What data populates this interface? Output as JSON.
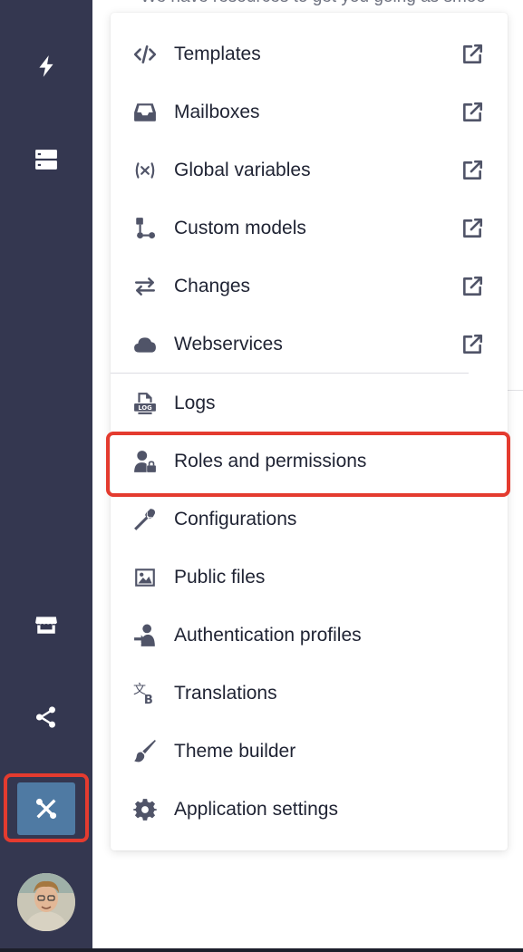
{
  "background": {
    "intro_text": "We have resources to get you going as smoo"
  },
  "sidebar": {
    "icons": [
      {
        "name": "bolt-icon"
      },
      {
        "name": "server-icon"
      },
      {
        "name": "store-icon"
      },
      {
        "name": "share-nodes-icon"
      },
      {
        "name": "tools-icon",
        "active": true
      }
    ],
    "active_color": "#4f7aa3",
    "background_color": "#343750"
  },
  "menu": {
    "external_items": [
      {
        "label": "Templates",
        "icon": "code-icon"
      },
      {
        "label": "Mailboxes",
        "icon": "inbox-icon"
      },
      {
        "label": "Global variables",
        "icon": "variable-icon"
      },
      {
        "label": "Custom models",
        "icon": "diagram-icon"
      },
      {
        "label": "Changes",
        "icon": "arrows-exchange-icon"
      },
      {
        "label": "Webservices",
        "icon": "cloud-icon"
      }
    ],
    "items": [
      {
        "label": "Logs",
        "icon": "log-file-icon"
      },
      {
        "label": "Roles and permissions",
        "icon": "user-lock-icon"
      },
      {
        "label": "Configurations",
        "icon": "wrench-icon"
      },
      {
        "label": "Public files",
        "icon": "image-icon"
      },
      {
        "label": "Authentication profiles",
        "icon": "user-login-icon"
      },
      {
        "label": "Translations",
        "icon": "translate-icon"
      },
      {
        "label": "Theme builder",
        "icon": "paintbrush-icon"
      },
      {
        "label": "Application settings",
        "icon": "gear-icon"
      }
    ],
    "highlight_color": "#e43b2f"
  }
}
